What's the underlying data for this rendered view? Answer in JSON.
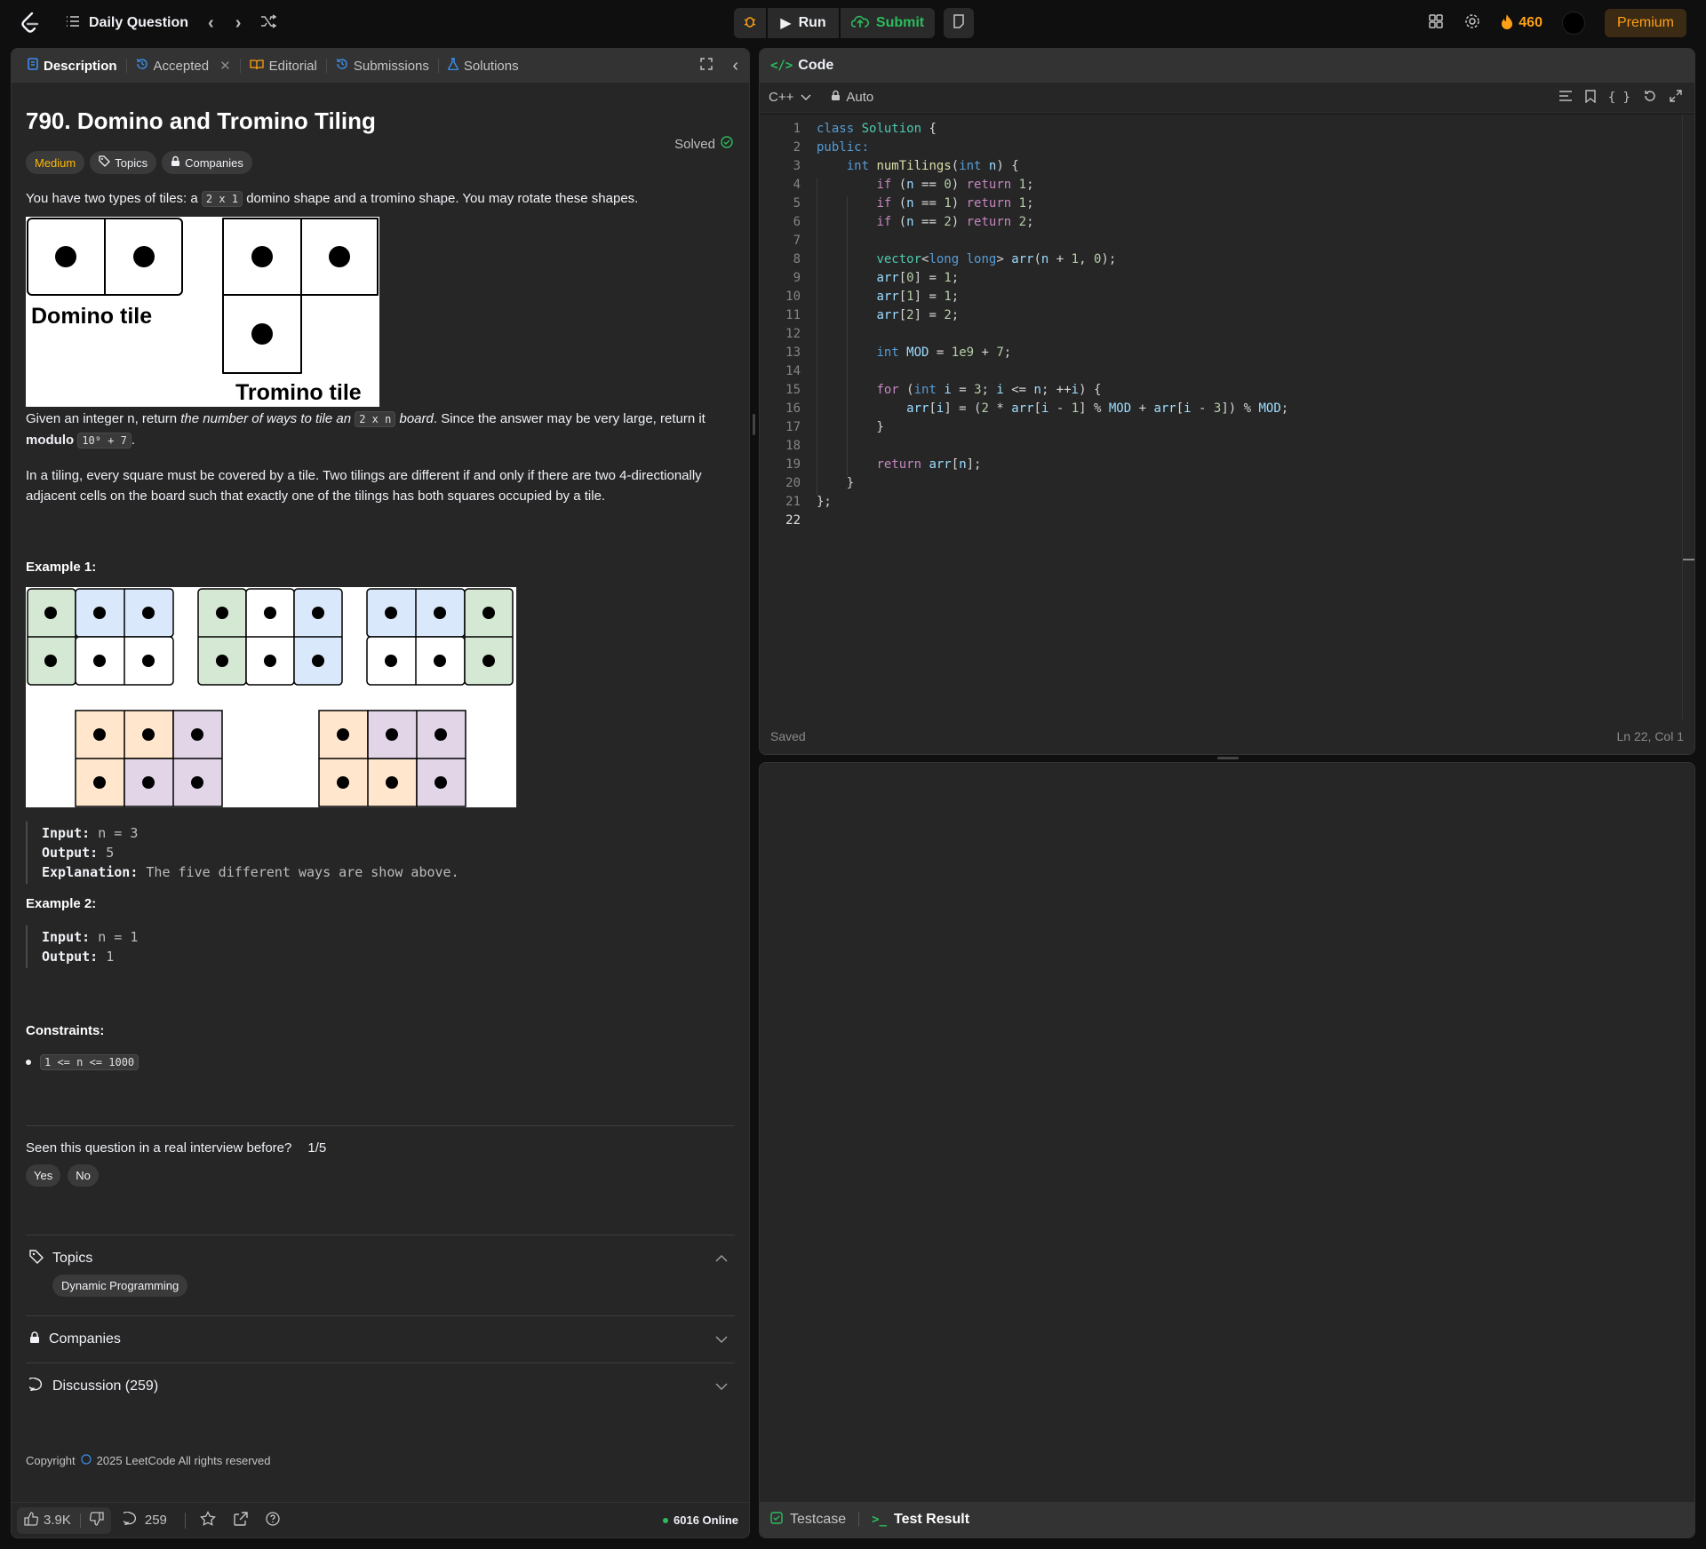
{
  "topbar": {
    "title": "Daily Question",
    "run_label": "Run",
    "submit_label": "Submit",
    "streak": "460",
    "premium": "Premium"
  },
  "tabs": [
    "Description",
    "Accepted",
    "Editorial",
    "Submissions",
    "Solutions"
  ],
  "problem": {
    "title": "790. Domino and Tromino Tiling",
    "status": "Solved",
    "difficulty": "Medium",
    "chip_topics": "Topics",
    "chip_companies": "Companies",
    "p1_a": "You have two types of tiles: a ",
    "p1_code": "2 x 1",
    "p1_b": " domino shape and a tromino shape. You may rotate these shapes.",
    "fig1_domino_label": "Domino tile",
    "fig1_tromino_label": "Tromino tile",
    "p2_a": "Given an integer n, return ",
    "p2_em": "the number of ways to tile an ",
    "p2_code": "2 x n",
    "p2_em2": " board",
    "p2_b": ". Since the answer may be very large, return it ",
    "p2_bold": "modulo",
    "p2_code2": "10⁹ + 7",
    "p2_end": ".",
    "p3": "In a tiling, every square must be covered by a tile. Two tilings are different if and only if there are two 4-directionally adjacent cells on the board such that exactly one of the tilings has both squares occupied by a tile.",
    "ex1_title": "Example 1:",
    "ex1_input_label": "Input:",
    "ex1_input": "n = 3",
    "ex1_output_label": "Output:",
    "ex1_output": "5",
    "ex1_expl_label": "Explanation:",
    "ex1_expl": "The five different ways are show above.",
    "ex2_title": "Example 2:",
    "ex2_input_label": "Input:",
    "ex2_input": "n = 1",
    "ex2_output_label": "Output:",
    "ex2_output": "1",
    "constraints_title": "Constraints:",
    "constraint1": "1 <= n <= 1000",
    "interview_q": "Seen this question in a real interview before?",
    "interview_count": "1/5",
    "yes": "Yes",
    "no": "No",
    "topics_label": "Topics",
    "topic_tag": "Dynamic Programming",
    "companies_label": "Companies",
    "discussion_label": "Discussion (259)",
    "copyright": "Copyright",
    "copyright_rest": "2025 LeetCode All rights reserved"
  },
  "bottom": {
    "likes": "3.9K",
    "comments": "259",
    "online": "6016 Online"
  },
  "editor": {
    "panel_title": "Code",
    "language": "C++",
    "mode": "Auto",
    "status": "Saved",
    "cursor": "Ln 22, Col 1",
    "lines": [
      "class Solution {",
      "public:",
      "    int numTilings(int n) {",
      "        if (n == 0) return 1;",
      "        if (n == 1) return 1;",
      "        if (n == 2) return 2;",
      "",
      "        vector<long long> arr(n + 1, 0);",
      "        arr[0] = 1;",
      "        arr[1] = 1;",
      "        arr[2] = 2;",
      "",
      "        int MOD = 1e9 + 7;",
      "",
      "        for (int i = 3; i <= n; ++i) {",
      "            arr[i] = (2 * arr[i - 1] % MOD + arr[i - 3]) % MOD;",
      "        }",
      "",
      "        return arr[n];",
      "    }",
      "};",
      ""
    ]
  },
  "test": {
    "testcase": "Testcase",
    "result": "Test Result"
  },
  "colors": {
    "accent": "#ffa116",
    "green": "#2cbb5d",
    "medium": "#ffb800",
    "panel": "#262626"
  }
}
